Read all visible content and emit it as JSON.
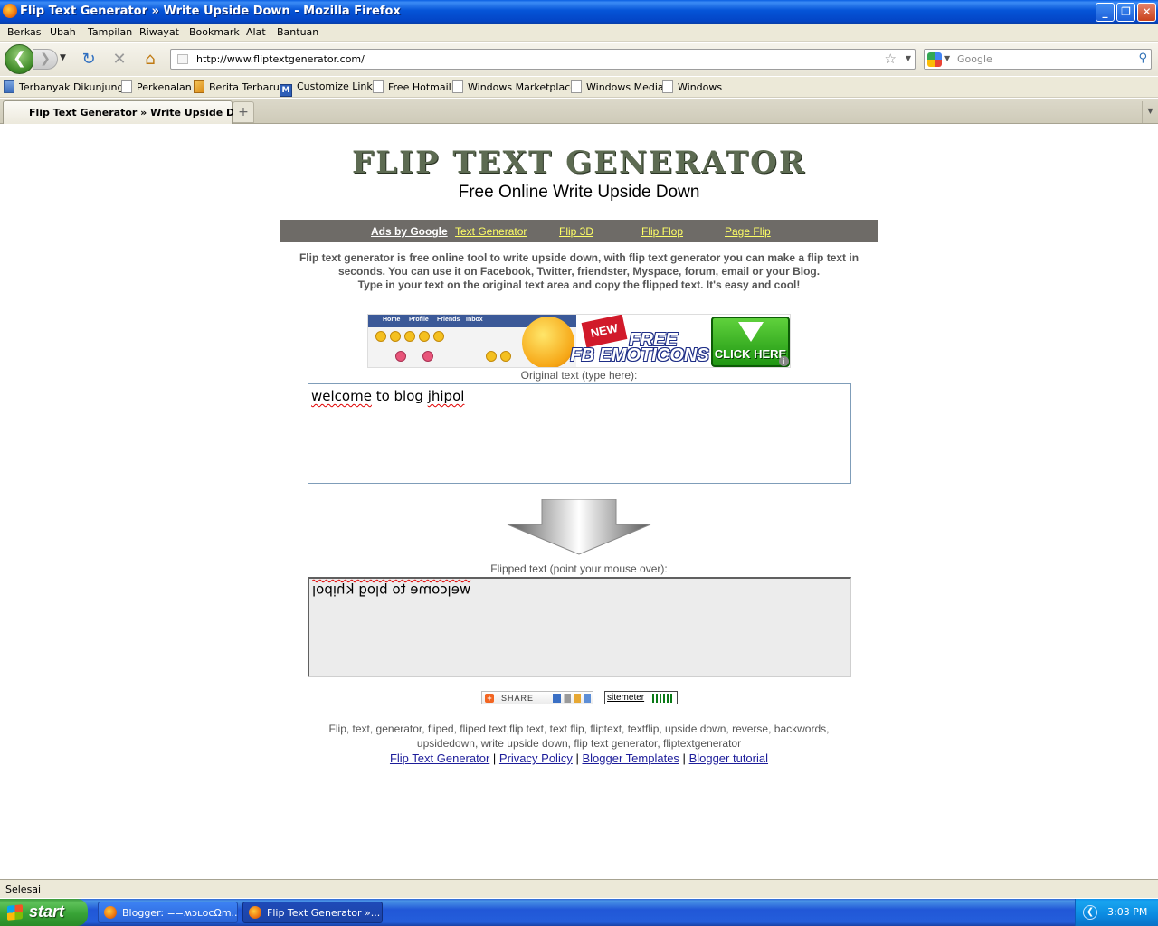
{
  "window": {
    "title": "Flip Text Generator » Write Upside Down - Mozilla Firefox",
    "controls": [
      "_",
      "❐",
      "✕"
    ]
  },
  "menu": [
    "Berkas",
    "Ubah",
    "Tampilan",
    "Riwayat",
    "Bookmark",
    "Alat",
    "Bantuan"
  ],
  "toolbar": {
    "url": "http://www.fliptextgenerator.com/",
    "search_placeholder": "Google"
  },
  "bookmarks": [
    "Terbanyak Dikunjungi",
    "Perkenalan",
    "Berita Terbaru",
    "Customize Links",
    "Free Hotmail",
    "Windows Marketplace",
    "Windows Media",
    "Windows"
  ],
  "tabs": [
    {
      "label": "Flip Text Generator » Write Upside D..."
    }
  ],
  "page": {
    "title": "FLIP TEXT GENERATOR",
    "subtitle": "Free Online Write Upside Down",
    "nav": {
      "ads": "Ads by Google",
      "links": [
        "Text Generator",
        "Flip 3D",
        "Flip Flop",
        "Page Flip"
      ]
    },
    "intro_line1": "Flip text generator is free online tool to write upside down, with flip text generator you can make a flip text in seconds. You can use it on Facebook, Twitter, friendster, Myspace, forum, email or your Blog.",
    "intro_line2": "Type in your text on the original text area and copy the flipped text. It's easy and cool!",
    "banner": {
      "fb_nav": [
        "Home",
        "Profile",
        "Friends",
        "Inbox"
      ],
      "new_tag": "NEW",
      "promo_line1": "FREE",
      "promo_line2": "FB EMOTICONS",
      "cta": "CLICK HERE"
    },
    "original_label": "Original text (type here):",
    "original_text": "welcome to blog jhipol",
    "original_text_part1": "welcome",
    "original_text_part2": " to blog ",
    "original_text_part3": "jhipol",
    "flipped_label": "Flipped text (point your mouse over):",
    "flipped_text": "lodiɥʞ ƃolq oʇ ǝɯoɔlǝʍ",
    "share_label": "SHARE",
    "sitemeter_label": "sitemeter",
    "keywords": "Flip, text, generator, fliped, fliped text,flip text, text flip, fliptext, textflip, upside down, reverse, backwords, upsidedown, write upside down, flip text generator, fliptextgenerator",
    "footer_links": [
      "Flip Text Generator",
      "Privacy Policy",
      "Blogger Templates",
      "Blogger tutorial"
    ],
    "footer_sep": "|"
  },
  "status": "Selesai",
  "taskbar": {
    "start": "start",
    "tasks": [
      "Blogger: ==ʍɔʟocΩm...",
      "Flip Text Generator »..."
    ],
    "clock": "3:03 PM"
  }
}
